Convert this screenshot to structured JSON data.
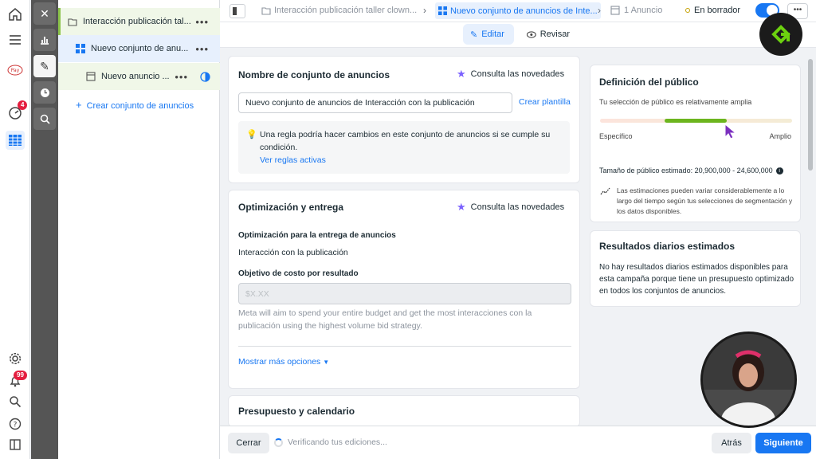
{
  "tree": {
    "campaign": "Interacción publicación tal...",
    "adset": "Nuevo conjunto de anu...",
    "ad": "Nuevo anuncio ...",
    "create": "Crear conjunto de anuncios",
    "more": "•••"
  },
  "rail": {
    "notif_badge": "4",
    "alerts_badge": "99"
  },
  "topbar": {
    "crumb_campaign": "Interacción publicación taller clown...",
    "crumb_adset": "Nuevo conjunto de anuncios de Inte...",
    "crumb_ad": "1 Anuncio",
    "status": "En borrador"
  },
  "subbar": {
    "edit": "Editar",
    "review": "Revisar"
  },
  "adset_card": {
    "title": "Nombre de conjunto de anuncios",
    "news": "Consulta las novedades",
    "name_value": "Nuevo conjunto de anuncios de Interacción con la publicación",
    "template_link": "Crear plantilla",
    "rule_note": "Una regla podría hacer cambios en este conjunto de anuncios si se cumple su condición.",
    "rule_link": "Ver reglas activas"
  },
  "opt_card": {
    "title": "Optimización y entrega",
    "news": "Consulta las novedades",
    "opt_label": "Optimización para la entrega de anuncios",
    "opt_value": "Interacción con la publicación",
    "cost_label": "Objetivo de costo por resultado",
    "cost_placeholder": "$X.XX",
    "cost_help": "Meta will aim to spend your entire budget and get the most interacciones con la publicación using the highest volume bid strategy.",
    "more_options": "Mostrar más opciones"
  },
  "budget_card": {
    "title": "Presupuesto y calendario"
  },
  "audience_card": {
    "title": "Definición del público",
    "subtitle": "Tu selección de público es relativamente amplia",
    "left": "Específico",
    "right": "Amplio",
    "size": "Tamaño de público estimado: 20,900,000 - 24,600,000",
    "estimate_note": "Las estimaciones pueden variar considerablemente a lo largo del tiempo según tus selecciones de segmentación y los datos disponibles.",
    "breadth_level": 0.66
  },
  "results_card": {
    "title": "Resultados diarios estimados",
    "body": "No hay resultados diarios estimados disponibles para esta campaña porque tiene un presupuesto optimizado en todos los conjuntos de anuncios."
  },
  "bottom": {
    "close": "Cerrar",
    "verifying": "Verificando tus ediciones...",
    "back": "Atrás",
    "next": "Siguiente"
  },
  "colors": {
    "accent": "#1877f2",
    "green": "#6cb51e",
    "tree_green": "#8bc34a"
  }
}
